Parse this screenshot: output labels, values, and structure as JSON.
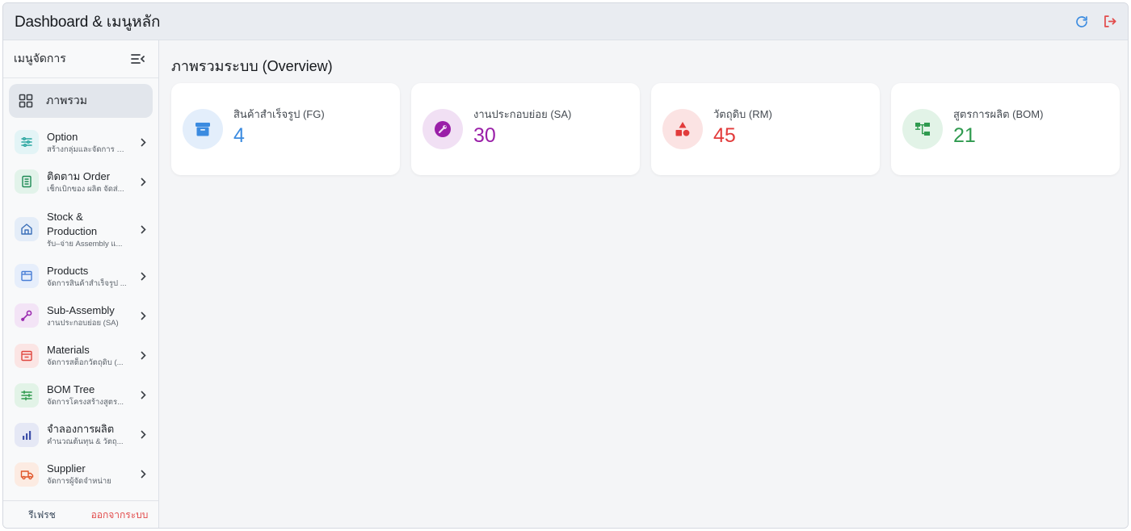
{
  "topbar": {
    "title": "Dashboard & เมนูหลัก",
    "refresh_icon": "refresh-icon",
    "logout_icon": "logout-icon"
  },
  "sidebar": {
    "title": "เมนูจัดการ",
    "active": {
      "label": "ภาพรวม",
      "icon": "grid-icon"
    },
    "items": [
      {
        "title": "Option",
        "sub": "สร้างกลุ่มและจัดการ O...",
        "icon": "sliders-icon",
        "color": "#2aa6a0",
        "bg": "#e3f4f6"
      },
      {
        "title": "ติดตาม Order",
        "sub": "เช็กเบิกของ ผลิต จัดส่...",
        "icon": "checklist-icon",
        "color": "#1e8a55",
        "bg": "#e2f3ea"
      },
      {
        "title": "Stock & Production",
        "sub": "รับ–จ่าย Assembly แ...",
        "icon": "warehouse-icon",
        "color": "#3a6fb8",
        "bg": "#e4edf8"
      },
      {
        "title": "Products",
        "sub": "จัดการสินค้าสำเร็จรูป ...",
        "icon": "box-icon",
        "color": "#4a7fd6",
        "bg": "#e6eefb"
      },
      {
        "title": "Sub-Assembly",
        "sub": "งานประกอบย่อย (SA)",
        "icon": "wrench-icon",
        "color": "#9b2bb0",
        "bg": "#f3e4f6"
      },
      {
        "title": "Materials",
        "sub": "จัดการสต็อกวัตถุดิบ (...",
        "icon": "materials-icon",
        "color": "#e0463f",
        "bg": "#fbe5e4"
      },
      {
        "title": "BOM Tree",
        "sub": "จัดการโครงสร้างสูตร...",
        "icon": "tree-icon",
        "color": "#2f9a4f",
        "bg": "#e2f3e7"
      },
      {
        "title": "จำลองการผลิต",
        "sub": "คำนวณต้นทุน & วัตถุ...",
        "icon": "bar-chart-icon",
        "color": "#3d4fa8",
        "bg": "#e5e8f5"
      },
      {
        "title": "Supplier",
        "sub": "จัดการผู้จัดจำหน่าย",
        "icon": "truck-icon",
        "color": "#e0562a",
        "bg": "#fcebe2"
      }
    ],
    "footer": {
      "refresh": "รีเฟรช",
      "logout": "ออกจากระบบ"
    }
  },
  "main": {
    "title": "ภาพรวมระบบ (Overview)",
    "cards": [
      {
        "label": "สินค้าสำเร็จรูป (FG)",
        "value": "4",
        "icon": "archive-icon",
        "color": "#3b8be0",
        "bg": "#e3eefb"
      },
      {
        "label": "งานประกอบย่อย (SA)",
        "value": "30",
        "icon": "wrench-icon",
        "color": "#9a1fa8",
        "bg": "#f1e0f4"
      },
      {
        "label": "วัตถุดิบ (RM)",
        "value": "45",
        "icon": "shapes-icon",
        "color": "#e23b3b",
        "bg": "#fbe3e3"
      },
      {
        "label": "สูตรการผลิต (BOM)",
        "value": "21",
        "icon": "hierarchy-icon",
        "color": "#2f9a4f",
        "bg": "#e2f3e7"
      }
    ]
  }
}
